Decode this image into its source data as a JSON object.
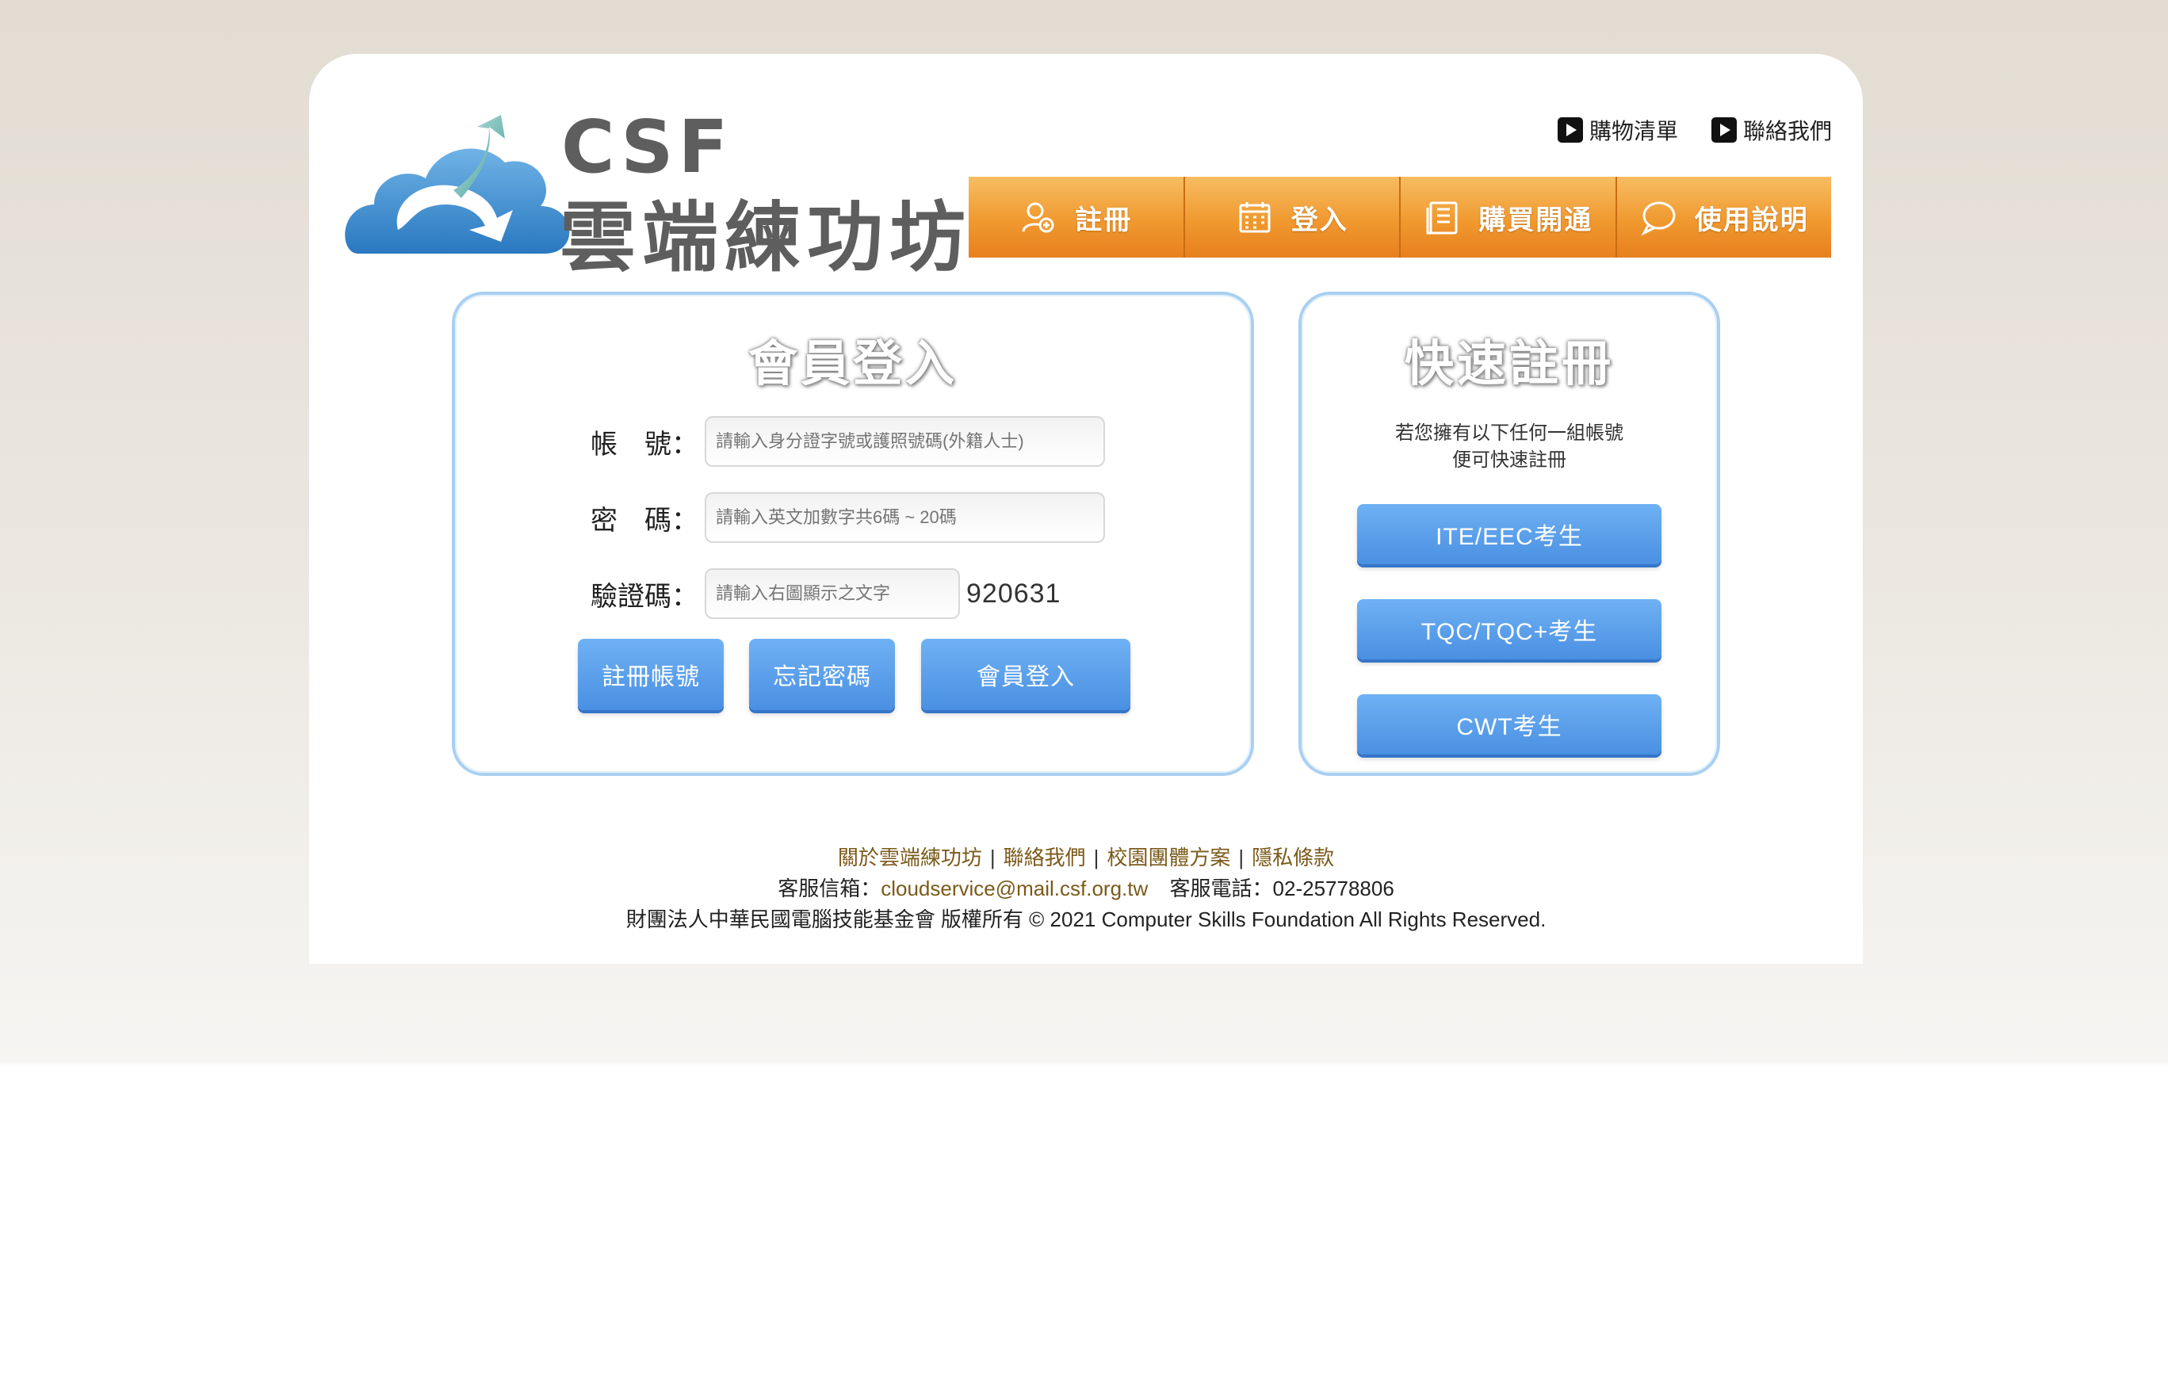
{
  "brand": {
    "logo_text_en": "CSF",
    "logo_text_cn": "雲端練功坊"
  },
  "top_links": [
    {
      "label": "購物清單"
    },
    {
      "label": "聯絡我們"
    }
  ],
  "nav": [
    {
      "label": "註冊"
    },
    {
      "label": "登入"
    },
    {
      "label": "購買開通"
    },
    {
      "label": "使用說明"
    }
  ],
  "login": {
    "title": "會員登入",
    "account_label": "帳　號：",
    "account_placeholder": "請輸入身分證字號或護照號碼(外籍人士)",
    "password_label": "密　碼：",
    "password_placeholder": "請輸入英文加數字共6碼 ~ 20碼",
    "captcha_label": "驗證碼：",
    "captcha_placeholder": "請輸入右圖顯示之文字",
    "captcha_text": "920631",
    "register_button": "註冊帳號",
    "forgot_button": "忘記密碼",
    "login_button": "會員登入"
  },
  "quick_register": {
    "title": "快速註冊",
    "desc_line1": "若您擁有以下任何一組帳號",
    "desc_line2": "便可快速註冊",
    "buttons": [
      "ITE/EEC考生",
      "TQC/TQC+考生",
      "CWT考生"
    ]
  },
  "footer": {
    "links": [
      "關於雲端練功坊",
      "聯絡我們",
      "校園團體方案",
      "隱私條款"
    ],
    "email_label": "客服信箱：",
    "email": "cloudservice@mail.csf.org.tw",
    "phone_label": "客服電話：",
    "phone": "02-25778806",
    "copyright": "財團法人中華民國電腦技能基金會 版權所有 © 2021 Computer Skills Foundation All Rights Reserved."
  },
  "colors": {
    "nav_orange": "#f0992f",
    "button_blue": "#4a90e2",
    "panel_border": "#a9d0f2",
    "footer_link": "#7b5a1a"
  }
}
